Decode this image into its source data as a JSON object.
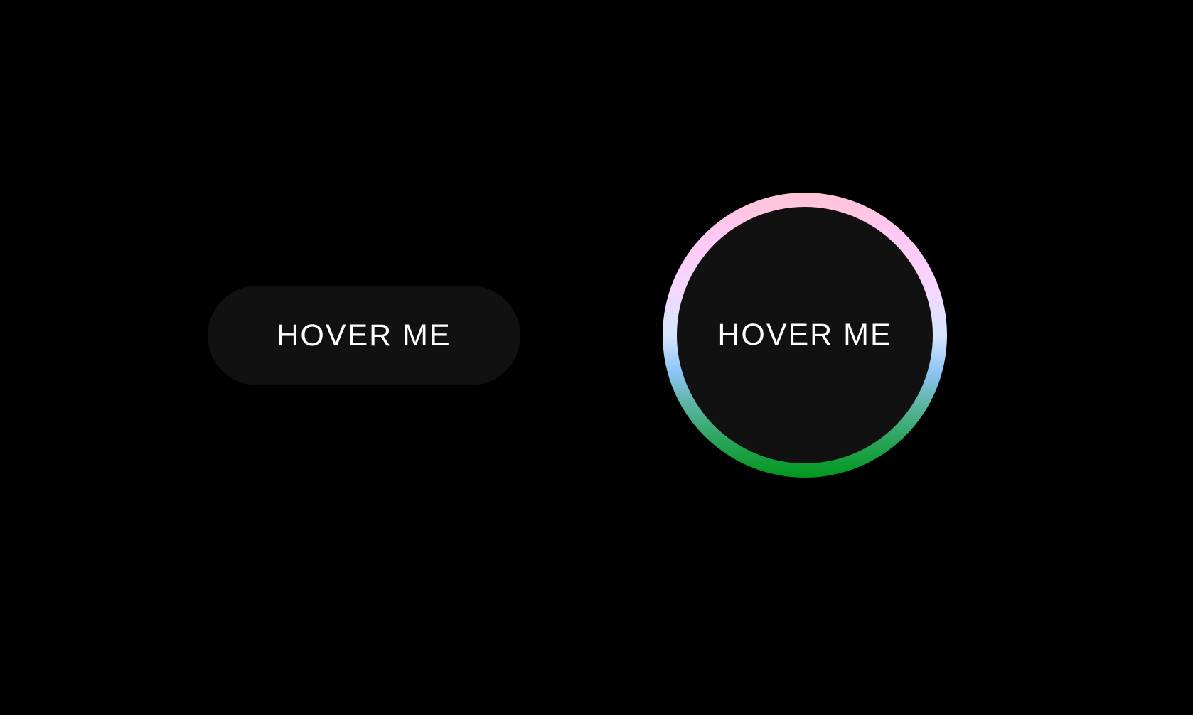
{
  "buttons": {
    "pill": {
      "label": "HOVER ME"
    },
    "circle": {
      "label": "HOVER ME"
    }
  },
  "colors": {
    "background": "#000000",
    "button_fill": "#111111",
    "button_text": "#ffffff",
    "ring_gradient": [
      "#ffc3d4",
      "#ffc8f4",
      "#f3d8ff",
      "#d6e6ff",
      "#8cc4f5",
      "#5bb3a0",
      "#2aa45a",
      "#00981c"
    ]
  }
}
